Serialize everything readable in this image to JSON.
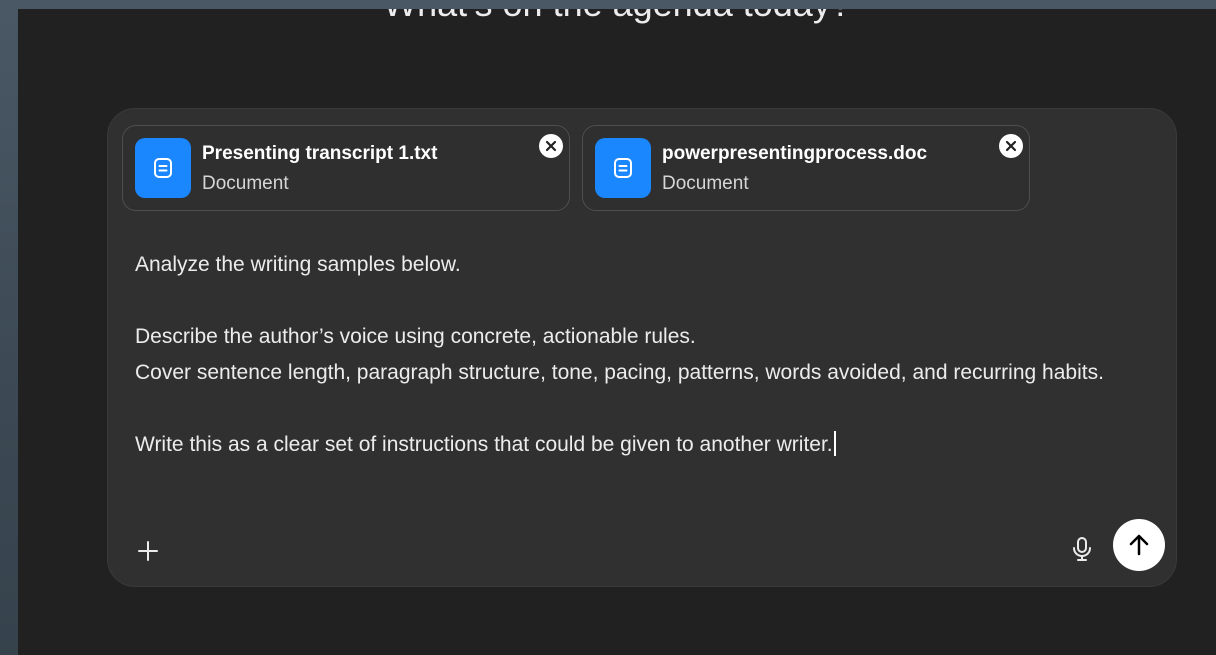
{
  "heading": "What’s on the agenda today?",
  "attachments": [
    {
      "name": "Presenting transcript 1.txt",
      "type": "Document",
      "icon": "document-icon"
    },
    {
      "name": "powerpresentingprocess.doc",
      "type": "Document",
      "icon": "document-icon"
    }
  ],
  "prompt": {
    "lines": [
      "Analyze the writing samples below.",
      "",
      "Describe the author’s voice using concrete, actionable rules.",
      "Cover sentence length, paragraph structure, tone, pacing, patterns, words avoided, and recurring habits.",
      "",
      "Write this as a clear set of instructions that could be given to another writer."
    ]
  },
  "controls": {
    "add_icon": "plus-icon",
    "mic_icon": "microphone-icon",
    "send_icon": "arrow-up-icon",
    "remove_icon": "close-icon"
  },
  "colors": {
    "background": "#212121",
    "composer": "#303030",
    "file_icon_bg": "#1a87ff",
    "send_button": "#ffffff"
  }
}
